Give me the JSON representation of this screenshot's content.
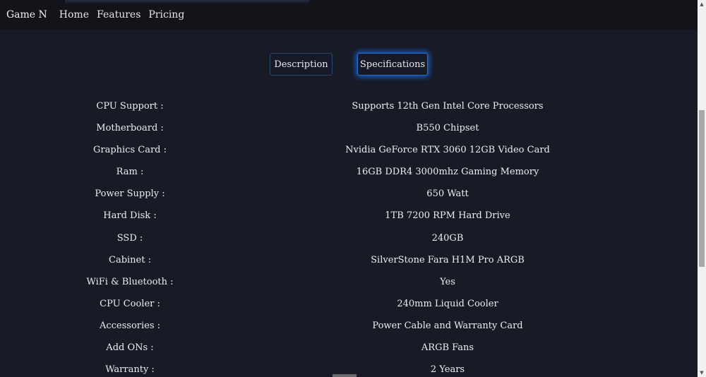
{
  "navbar": {
    "brand": "Game N",
    "links": [
      {
        "label": "Home"
      },
      {
        "label": "Features"
      },
      {
        "label": "Pricing"
      }
    ]
  },
  "tabs": {
    "description_label": "Description",
    "specifications_label": "Specifications",
    "active": "Specifications"
  },
  "specs": [
    {
      "label": "CPU Support :",
      "value": "Supports 12th Gen Intel Core Processors"
    },
    {
      "label": "Motherboard :",
      "value": "B550 Chipset"
    },
    {
      "label": "Graphics Card :",
      "value": "Nvidia GeForce RTX 3060 12GB Video Card"
    },
    {
      "label": "Ram :",
      "value": "16GB DDR4 3000mhz Gaming Memory"
    },
    {
      "label": "Power Supply :",
      "value": "650 Watt"
    },
    {
      "label": "Hard Disk :",
      "value": "1TB 7200 RPM Hard Drive"
    },
    {
      "label": "SSD :",
      "value": "240GB"
    },
    {
      "label": "Cabinet :",
      "value": "SilverStone Fara H1M Pro ARGB"
    },
    {
      "label": "WiFi & Bluetooth :",
      "value": "Yes"
    },
    {
      "label": "CPU Cooler :",
      "value": "240mm Liquid Cooler"
    },
    {
      "label": "Accessories :",
      "value": "Power Cable and Warranty Card"
    },
    {
      "label": "Add ONs :",
      "value": "ARGB Fans"
    },
    {
      "label": "Warranty :",
      "value": "2 Years"
    }
  ],
  "colors": {
    "background": "#181a26",
    "navbar": "#121419",
    "accent_glow": "#1e78ff"
  }
}
